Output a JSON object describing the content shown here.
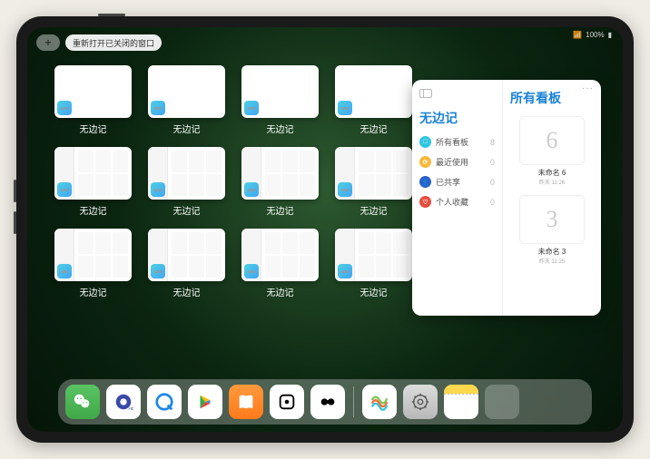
{
  "status": {
    "signal": "📶",
    "battery_text": "100%"
  },
  "top": {
    "plus": "+",
    "reopen_label": "重新打开已关闭的窗口"
  },
  "window_label": "无边记",
  "windows": [
    {
      "type": "blank"
    },
    {
      "type": "content"
    },
    {
      "type": "content"
    },
    {
      "type": "blank"
    },
    {
      "type": "content"
    },
    {
      "type": "content"
    },
    {
      "type": "blank"
    },
    {
      "type": "content"
    },
    {
      "type": "content"
    },
    {
      "type": "blank"
    },
    {
      "type": "content"
    },
    {
      "type": "content"
    }
  ],
  "expanded": {
    "more": "···",
    "left_title": "无边记",
    "right_title": "所有看板",
    "items": [
      {
        "icon_bg": "#2fc6e0",
        "glyph": "□",
        "label": "所有看板",
        "count": "8"
      },
      {
        "icon_bg": "#f6b93b",
        "glyph": "⟳",
        "label": "最近使用",
        "count": "0"
      },
      {
        "icon_bg": "#2a60c8",
        "glyph": "👤",
        "label": "已共享",
        "count": "0"
      },
      {
        "icon_bg": "#e74c3c",
        "glyph": "♡",
        "label": "个人收藏",
        "count": "0"
      }
    ],
    "boards": [
      {
        "glyph": "6",
        "label": "未命名 6",
        "sub": "昨天 11:26"
      },
      {
        "glyph": "3",
        "label": "未命名 3",
        "sub": "昨天 11:25"
      }
    ]
  },
  "dock": [
    {
      "name": "wechat"
    },
    {
      "name": "qhd"
    },
    {
      "name": "qbrowser"
    },
    {
      "name": "play"
    },
    {
      "name": "books"
    },
    {
      "name": "dice"
    },
    {
      "name": "oo"
    },
    {
      "sep": true
    },
    {
      "name": "freeform"
    },
    {
      "name": "settings"
    },
    {
      "name": "notes"
    },
    {
      "name": "folder"
    }
  ],
  "folder_colors": [
    "#4dd0e1",
    "#7e8cf0",
    "#64d169",
    "#2aa3ef"
  ]
}
